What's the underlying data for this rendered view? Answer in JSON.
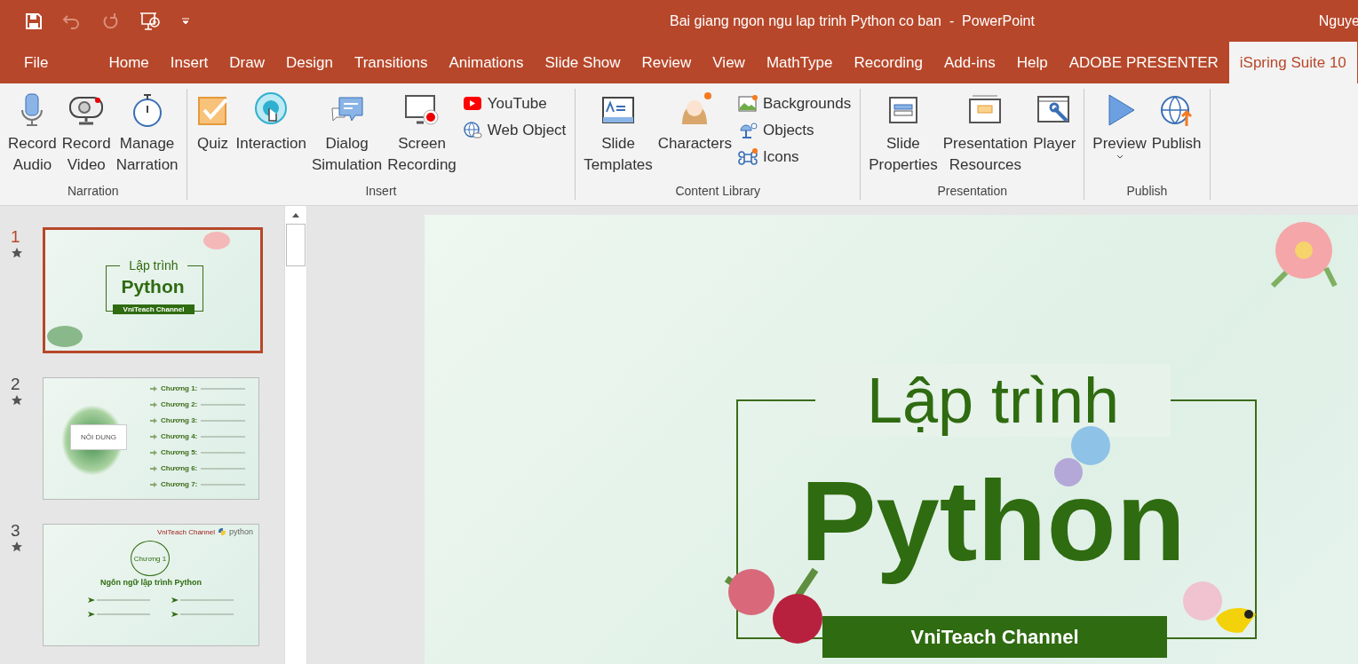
{
  "window": {
    "title": "Bai giang ngon ngu lap trinh Python co ban  -  PowerPoint",
    "user": "Nguye"
  },
  "tabs": [
    {
      "label": "File",
      "selected": false
    },
    {
      "label": "Home",
      "selected": false
    },
    {
      "label": "Insert",
      "selected": false
    },
    {
      "label": "Draw",
      "selected": false
    },
    {
      "label": "Design",
      "selected": false
    },
    {
      "label": "Transitions",
      "selected": false
    },
    {
      "label": "Animations",
      "selected": false
    },
    {
      "label": "Slide Show",
      "selected": false
    },
    {
      "label": "Review",
      "selected": false
    },
    {
      "label": "View",
      "selected": false
    },
    {
      "label": "MathType",
      "selected": false
    },
    {
      "label": "Recording",
      "selected": false
    },
    {
      "label": "Add-ins",
      "selected": false
    },
    {
      "label": "Help",
      "selected": false
    },
    {
      "label": "ADOBE PRESENTER",
      "selected": false
    },
    {
      "label": "iSpring Suite 10",
      "selected": true
    }
  ],
  "ribbon": [
    {
      "name": "Narration",
      "buttons": [
        {
          "kind": "large",
          "label": "Record\nAudio"
        },
        {
          "kind": "large",
          "label": "Record\nVideo"
        },
        {
          "kind": "large",
          "label": "Manage\nNarration"
        }
      ]
    },
    {
      "name": "Insert",
      "buttons": [
        {
          "kind": "large",
          "label": "Quiz"
        },
        {
          "kind": "large",
          "label": "Interaction"
        },
        {
          "kind": "large",
          "label": "Dialog\nSimulation"
        },
        {
          "kind": "large",
          "label": "Screen\nRecording"
        },
        {
          "kind": "small",
          "label": "YouTube"
        },
        {
          "kind": "small",
          "label": "Web Object"
        }
      ]
    },
    {
      "name": "Content Library",
      "buttons": [
        {
          "kind": "large",
          "label": "Slide\nTemplates"
        },
        {
          "kind": "large",
          "label": "Characters"
        },
        {
          "kind": "small",
          "label": "Backgrounds"
        },
        {
          "kind": "small",
          "label": "Objects"
        },
        {
          "kind": "small",
          "label": "Icons"
        }
      ]
    },
    {
      "name": "Presentation",
      "buttons": [
        {
          "kind": "large",
          "label": "Slide\nProperties"
        },
        {
          "kind": "large",
          "label": "Presentation\nResources"
        },
        {
          "kind": "large",
          "label": "Player"
        }
      ]
    },
    {
      "name": "Publish",
      "buttons": [
        {
          "kind": "dropdown",
          "label": "Preview"
        },
        {
          "kind": "large",
          "label": "Publish"
        }
      ]
    }
  ],
  "slides": [
    {
      "number": "1",
      "selected": true,
      "kind": "title",
      "title": "Lập trình",
      "subtitle": "Python",
      "band": "VniTeach Channel"
    },
    {
      "number": "2",
      "selected": false,
      "kind": "agenda",
      "title": "NỘI DUNG",
      "items": [
        {
          "label": "Chương 1:"
        },
        {
          "label": "Chương 2:"
        },
        {
          "label": "Chương 3:"
        },
        {
          "label": "Chương 4:"
        },
        {
          "label": "Chương 5:"
        },
        {
          "label": "Chương 6:"
        },
        {
          "label": "Chương 7:"
        }
      ]
    },
    {
      "number": "3",
      "selected": false,
      "kind": "chapter",
      "channel": "VniTeach Channel",
      "logo": "python",
      "badge": "Chương 1",
      "title": "Ngôn ngữ lập trình Python"
    }
  ],
  "current_slide": {
    "title": "Lập trình",
    "subtitle": "Python",
    "band": "VniTeach Channel"
  }
}
